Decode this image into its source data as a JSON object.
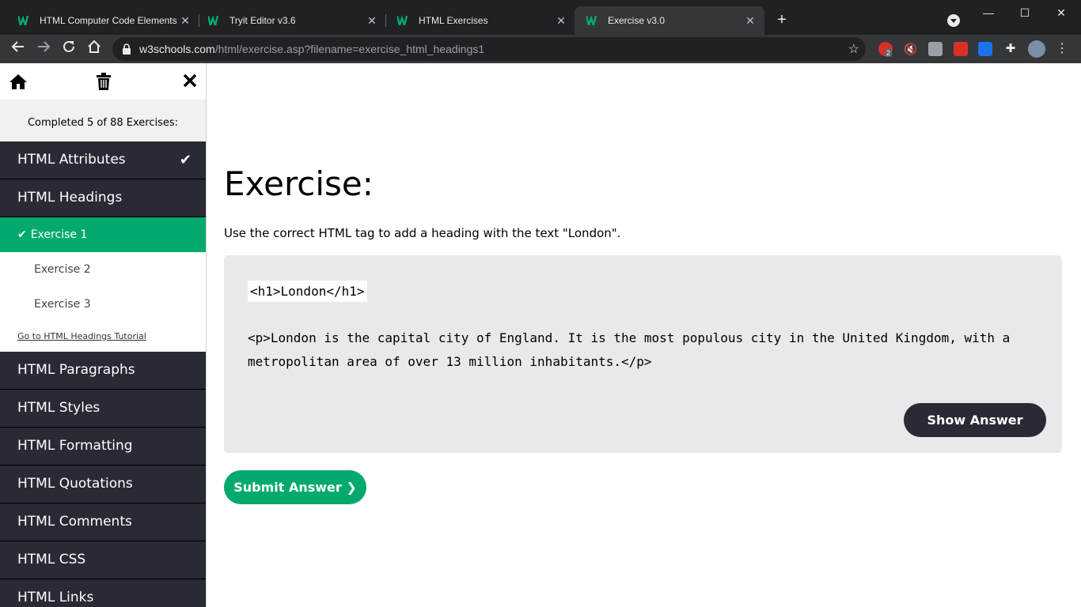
{
  "browser": {
    "tabs": [
      {
        "title": "HTML Computer Code Elements"
      },
      {
        "title": "Tryit Editor v3.6"
      },
      {
        "title": "HTML Exercises"
      },
      {
        "title": "Exercise v3.0"
      }
    ],
    "url_host": "w3schools.com",
    "url_path": "/html/exercise.asp?filename=exercise_html_headings1",
    "extension_badge": "2"
  },
  "sidebar": {
    "progress": "Completed 5 of 88 Exercises:",
    "items": [
      {
        "label": "HTML Attributes"
      },
      {
        "label": "HTML Headings"
      },
      {
        "label": "HTML Paragraphs"
      },
      {
        "label": "HTML Styles"
      },
      {
        "label": "HTML Formatting"
      },
      {
        "label": "HTML Quotations"
      },
      {
        "label": "HTML Comments"
      },
      {
        "label": "HTML CSS"
      },
      {
        "label": "HTML Links"
      }
    ],
    "sub_items": [
      {
        "label": "Exercise 1"
      },
      {
        "label": "Exercise 2"
      },
      {
        "label": "Exercise 3"
      }
    ],
    "tutorial_link": "Go to HTML Headings Tutorial"
  },
  "main": {
    "title": "Exercise:",
    "instruction": "Use the correct HTML tag to add a heading with the text \"London\".",
    "code_answer": "<h1>London</h1>",
    "code_paragraph": "<p>London is the capital city of England. It is the most populous city in the United Kingdom, with a metropolitan area of over 13 million inhabitants.</p>",
    "show_answer": "Show Answer",
    "submit_answer": "Submit Answer ❯"
  },
  "colors": {
    "accent_green": "#04aa6d",
    "sidebar_dark": "#282a35",
    "code_bg": "#e7e9eb"
  }
}
